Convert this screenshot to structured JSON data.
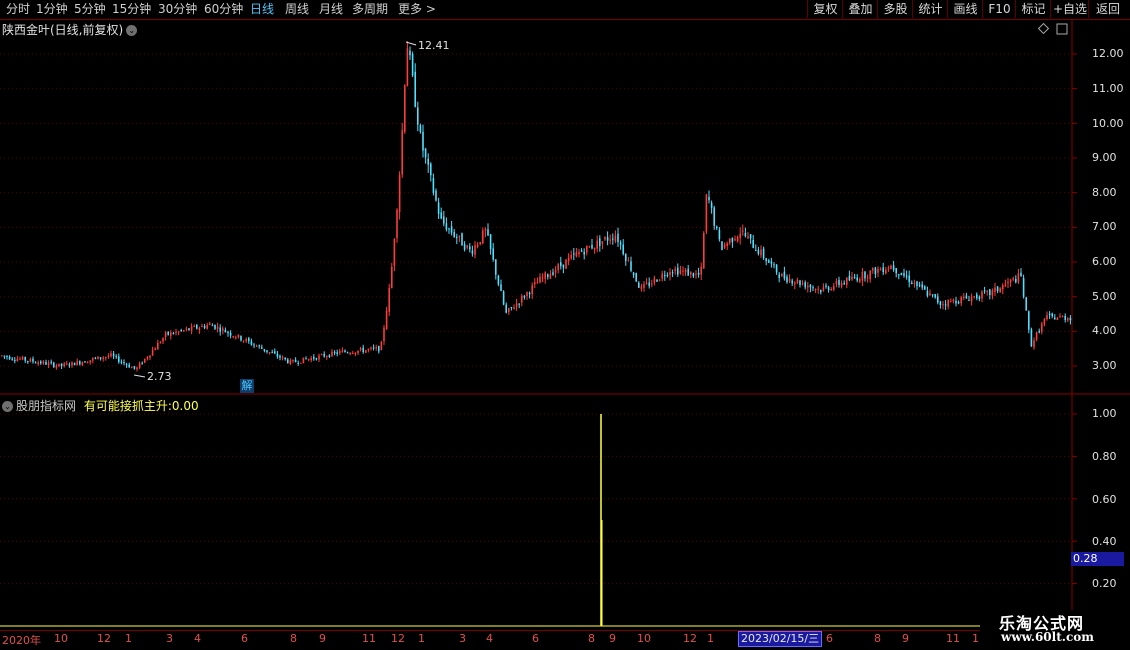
{
  "toolbar": {
    "periods": [
      "分时",
      "1分钟",
      "5分钟",
      "15分钟",
      "30分钟",
      "60分钟",
      "日线",
      "周线",
      "月线",
      "多周期",
      "更多 >"
    ],
    "active_period": "日线",
    "right_buttons": [
      "复权",
      "叠加",
      "多股",
      "统计",
      "画线",
      "F10",
      "标记",
      "+自选",
      "返回"
    ]
  },
  "main_chart": {
    "title": "陕西金叶(日线,前复权)",
    "high_label": "12.41",
    "low_label": "2.73",
    "marker": "解",
    "price_ticks": [
      "12.00",
      "11.00",
      "10.00",
      "9.00",
      "8.00",
      "7.00",
      "6.00",
      "5.00",
      "4.00",
      "3.00"
    ]
  },
  "indicator": {
    "source": "股朋指标网",
    "name": "有可能接抓主升:",
    "value": "0.00",
    "ticks": [
      "1.00",
      "0.80",
      "0.60",
      "0.40",
      "0.20"
    ],
    "cursor_value": "0.28"
  },
  "date_axis": {
    "labels": [
      "2020年",
      "10",
      "12",
      "1",
      "3",
      "4",
      "6",
      "8",
      "9",
      "11",
      "12",
      "1",
      "3",
      "4",
      "6",
      "8",
      "9",
      "10",
      "12",
      "1",
      "6",
      "8",
      "9",
      "11",
      "1"
    ],
    "selected_date": "2023/02/15/三"
  },
  "watermark": {
    "line1": "乐淘公式网",
    "line2": "www.60lt.com"
  },
  "colors": {
    "up": "#ff3c3c",
    "down": "#4fe0ff",
    "axis": "#8a0000",
    "signal": "#ffff40",
    "grid": "#5a0000"
  },
  "chart_data": {
    "type": "candlestick",
    "series": [
      {
        "name": "陕西金叶",
        "description_points": [
          {
            "x": 0,
            "y": 3.3
          },
          {
            "x": 60,
            "y": 3.0
          },
          {
            "x": 110,
            "y": 3.3
          },
          {
            "x": 135,
            "y": 2.9
          },
          {
            "x": 165,
            "y": 3.9
          },
          {
            "x": 210,
            "y": 4.2
          },
          {
            "x": 240,
            "y": 3.8
          },
          {
            "x": 290,
            "y": 3.1
          },
          {
            "x": 340,
            "y": 3.4
          },
          {
            "x": 380,
            "y": 3.5
          },
          {
            "x": 390,
            "y": 5.5
          },
          {
            "x": 400,
            "y": 9.0
          },
          {
            "x": 406,
            "y": 12.41
          },
          {
            "x": 420,
            "y": 9.5
          },
          {
            "x": 440,
            "y": 7.2
          },
          {
            "x": 470,
            "y": 6.3
          },
          {
            "x": 485,
            "y": 6.9
          },
          {
            "x": 505,
            "y": 4.5
          },
          {
            "x": 540,
            "y": 5.5
          },
          {
            "x": 580,
            "y": 6.3
          },
          {
            "x": 615,
            "y": 6.8
          },
          {
            "x": 640,
            "y": 5.2
          },
          {
            "x": 670,
            "y": 5.8
          },
          {
            "x": 700,
            "y": 5.6
          },
          {
            "x": 706,
            "y": 8.0
          },
          {
            "x": 720,
            "y": 6.4
          },
          {
            "x": 740,
            "y": 6.9
          },
          {
            "x": 780,
            "y": 5.6
          },
          {
            "x": 820,
            "y": 5.2
          },
          {
            "x": 870,
            "y": 5.7
          },
          {
            "x": 890,
            "y": 5.9
          },
          {
            "x": 940,
            "y": 4.8
          },
          {
            "x": 990,
            "y": 5.1
          },
          {
            "x": 1020,
            "y": 5.6
          },
          {
            "x": 1030,
            "y": 3.6
          },
          {
            "x": 1045,
            "y": 4.4
          },
          {
            "x": 1070,
            "y": 4.4
          }
        ]
      }
    ],
    "signal": {
      "x": 601,
      "value": 1.0
    }
  }
}
